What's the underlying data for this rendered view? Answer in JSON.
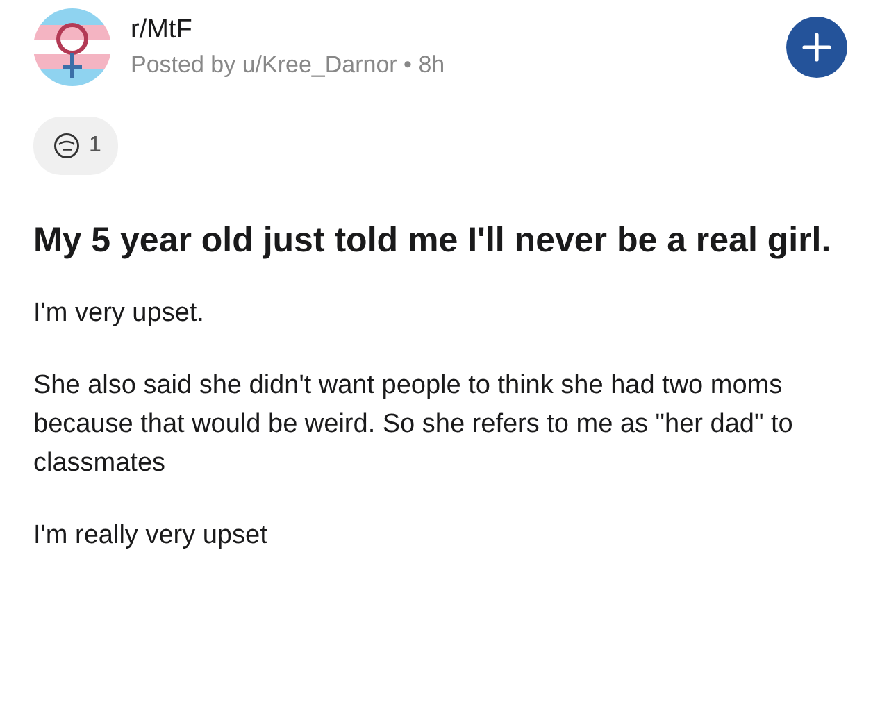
{
  "post": {
    "community": "r/MtF",
    "byline": "Posted by u/Kree_Darnor • 8h",
    "award": {
      "count": "1"
    },
    "title": "My 5 year old just told me I'll never be a real girl.",
    "paragraphs": [
      "I'm very upset.",
      "She also said she didn't want people to think she had two moms because that would be weird. So she refers to me as \"her dad\" to classmates",
      "I'm really very upset"
    ]
  }
}
